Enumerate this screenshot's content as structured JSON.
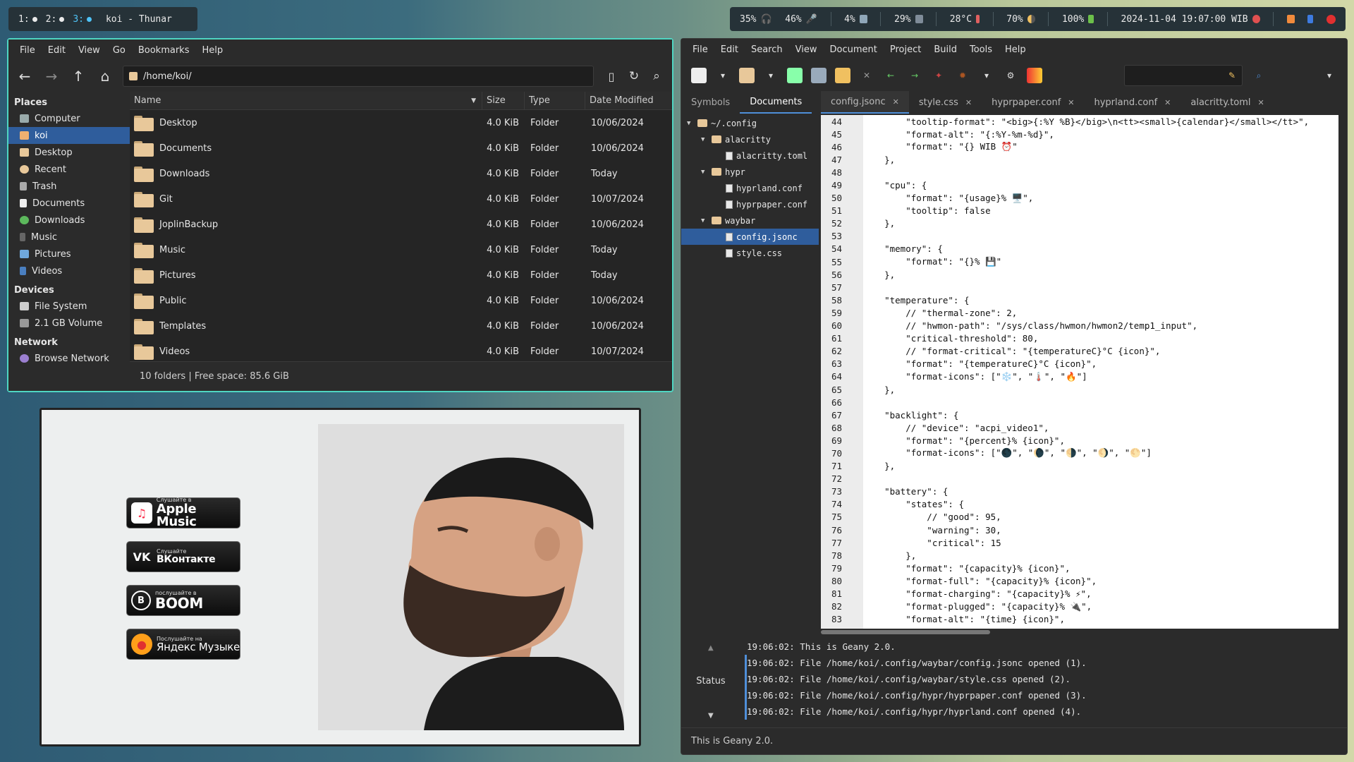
{
  "topbar": {
    "workspaces": [
      "1:",
      "2:",
      "3:"
    ],
    "active_workspace": "3:",
    "window_title": "koi - Thunar",
    "stats": {
      "volume": "35%",
      "mic": "46%",
      "cpu": "4%",
      "memory": "29%",
      "temperature": "28°C",
      "backlight": "70%",
      "battery": "100%",
      "clock": "2024-11-04 19:07:00 WIB"
    }
  },
  "thunar": {
    "menu": [
      "File",
      "Edit",
      "View",
      "Go",
      "Bookmarks",
      "Help"
    ],
    "path": "/home/koi/",
    "sidebar": {
      "places_header": "Places",
      "places": [
        "Computer",
        "koi",
        "Desktop",
        "Recent",
        "Trash",
        "Documents",
        "Downloads",
        "Music",
        "Pictures",
        "Videos"
      ],
      "devices_header": "Devices",
      "devices": [
        "File System",
        "2.1 GB Volume"
      ],
      "network_header": "Network",
      "network": [
        "Browse Network"
      ]
    },
    "columns": [
      "Name",
      "Size",
      "Type",
      "Date Modified"
    ],
    "rows": [
      {
        "name": "Desktop",
        "size": "4.0 KiB",
        "type": "Folder",
        "date": "10/06/2024"
      },
      {
        "name": "Documents",
        "size": "4.0 KiB",
        "type": "Folder",
        "date": "10/06/2024"
      },
      {
        "name": "Downloads",
        "size": "4.0 KiB",
        "type": "Folder",
        "date": "Today"
      },
      {
        "name": "Git",
        "size": "4.0 KiB",
        "type": "Folder",
        "date": "10/07/2024"
      },
      {
        "name": "JoplinBackup",
        "size": "4.0 KiB",
        "type": "Folder",
        "date": "10/06/2024"
      },
      {
        "name": "Music",
        "size": "4.0 KiB",
        "type": "Folder",
        "date": "Today"
      },
      {
        "name": "Pictures",
        "size": "4.0 KiB",
        "type": "Folder",
        "date": "Today"
      },
      {
        "name": "Public",
        "size": "4.0 KiB",
        "type": "Folder",
        "date": "10/06/2024"
      },
      {
        "name": "Templates",
        "size": "4.0 KiB",
        "type": "Folder",
        "date": "10/06/2024"
      },
      {
        "name": "Videos",
        "size": "4.0 KiB",
        "type": "Folder",
        "date": "10/07/2024"
      }
    ],
    "status": "10 folders  |  Free space: 85.6 GiB"
  },
  "viewer": {
    "badges": [
      {
        "small": "Слушайте в",
        "big": "Apple Music",
        "icon": "♫"
      },
      {
        "small": "Слушайте",
        "big": "ВКонтакте",
        "icon": "VK"
      },
      {
        "small": "послушайте в",
        "big": "BOOM",
        "icon": "B"
      },
      {
        "small": "Послушайте на",
        "big": "Яндекс Музыке",
        "icon": "●"
      }
    ]
  },
  "geany": {
    "menu": [
      "File",
      "Edit",
      "Search",
      "View",
      "Document",
      "Project",
      "Build",
      "Tools",
      "Help"
    ],
    "side_tabs": [
      "Symbols",
      "Documents"
    ],
    "tree": [
      {
        "label": "~/.config",
        "kind": "folder",
        "depth": 0
      },
      {
        "label": "alacritty",
        "kind": "folder",
        "depth": 1
      },
      {
        "label": "alacritty.toml",
        "kind": "file",
        "depth": 2
      },
      {
        "label": "hypr",
        "kind": "folder",
        "depth": 1
      },
      {
        "label": "hyprland.conf",
        "kind": "file",
        "depth": 2
      },
      {
        "label": "hyprpaper.conf",
        "kind": "file",
        "depth": 2
      },
      {
        "label": "waybar",
        "kind": "folder",
        "depth": 1
      },
      {
        "label": "config.jsonc",
        "kind": "file",
        "depth": 2
      },
      {
        "label": "style.css",
        "kind": "file",
        "depth": 2
      }
    ],
    "selected_file": "config.jsonc",
    "doc_tabs": [
      "config.jsonc",
      "style.css",
      "hyprpaper.conf",
      "hyprland.conf",
      "alacritty.toml"
    ],
    "code": [
      {
        "n": "44",
        "t": "        \"tooltip-format\": \"<big>{:%Y %B}</big>\\n<tt><small>{calendar}</small></tt>\","
      },
      {
        "n": "45",
        "t": "        \"format-alt\": \"{:%Y-%m-%d}\","
      },
      {
        "n": "46",
        "t": "        \"format\": \"{} WIB ⏰\""
      },
      {
        "n": "47",
        "t": "    },"
      },
      {
        "n": "48",
        "t": ""
      },
      {
        "n": "49",
        "t": "    \"cpu\": {"
      },
      {
        "n": "50",
        "t": "        \"format\": \"{usage}% 🖥️\","
      },
      {
        "n": "51",
        "t": "        \"tooltip\": false"
      },
      {
        "n": "52",
        "t": "    },"
      },
      {
        "n": "53",
        "t": ""
      },
      {
        "n": "54",
        "t": "    \"memory\": {"
      },
      {
        "n": "55",
        "t": "        \"format\": \"{}% 💾\""
      },
      {
        "n": "56",
        "t": "    },"
      },
      {
        "n": "57",
        "t": ""
      },
      {
        "n": "58",
        "t": "    \"temperature\": {"
      },
      {
        "n": "59",
        "t": "        // \"thermal-zone\": 2,"
      },
      {
        "n": "60",
        "t": "        // \"hwmon-path\": \"/sys/class/hwmon/hwmon2/temp1_input\","
      },
      {
        "n": "61",
        "t": "        \"critical-threshold\": 80,"
      },
      {
        "n": "62",
        "t": "        // \"format-critical\": \"{temperatureC}°C {icon}\","
      },
      {
        "n": "63",
        "t": "        \"format\": \"{temperatureC}°C {icon}\","
      },
      {
        "n": "64",
        "t": "        \"format-icons\": [\"❄️\", \"🌡️\", \"🔥\"]"
      },
      {
        "n": "65",
        "t": "    },"
      },
      {
        "n": "66",
        "t": ""
      },
      {
        "n": "67",
        "t": "    \"backlight\": {"
      },
      {
        "n": "68",
        "t": "        // \"device\": \"acpi_video1\","
      },
      {
        "n": "69",
        "t": "        \"format\": \"{percent}% {icon}\","
      },
      {
        "n": "70",
        "t": "        \"format-icons\": [\"🌑\", \"🌘\", \"🌗\", \"🌖\", \"🌕\"]"
      },
      {
        "n": "71",
        "t": "    },"
      },
      {
        "n": "72",
        "t": ""
      },
      {
        "n": "73",
        "t": "    \"battery\": {"
      },
      {
        "n": "74",
        "t": "        \"states\": {"
      },
      {
        "n": "75",
        "t": "            // \"good\": 95,"
      },
      {
        "n": "76",
        "t": "            \"warning\": 30,"
      },
      {
        "n": "77",
        "t": "            \"critical\": 15"
      },
      {
        "n": "78",
        "t": "        },"
      },
      {
        "n": "79",
        "t": "        \"format\": \"{capacity}% {icon}\","
      },
      {
        "n": "80",
        "t": "        \"format-full\": \"{capacity}% {icon}\","
      },
      {
        "n": "81",
        "t": "        \"format-charging\": \"{capacity}% ⚡\","
      },
      {
        "n": "82",
        "t": "        \"format-plugged\": \"{capacity}% 🔌\","
      },
      {
        "n": "83",
        "t": "        \"format-alt\": \"{time} {icon}\","
      }
    ],
    "messages": [
      "19:06:02: This is Geany 2.0.",
      "19:06:02: File /home/koi/.config/waybar/config.jsonc opened (1).",
      "19:06:02: File /home/koi/.config/waybar/style.css opened (2).",
      "19:06:02: File /home/koi/.config/hypr/hyprpaper.conf opened (3).",
      "19:06:02: File /home/koi/.config/hypr/hyprland.conf opened (4)."
    ],
    "msg_side_label": "Status",
    "statusbar": "This is Geany 2.0."
  },
  "colors": {
    "accent": "#4fd6c2",
    "selection": "#2f5d9c",
    "workspace_active": "#4fc3f7"
  }
}
